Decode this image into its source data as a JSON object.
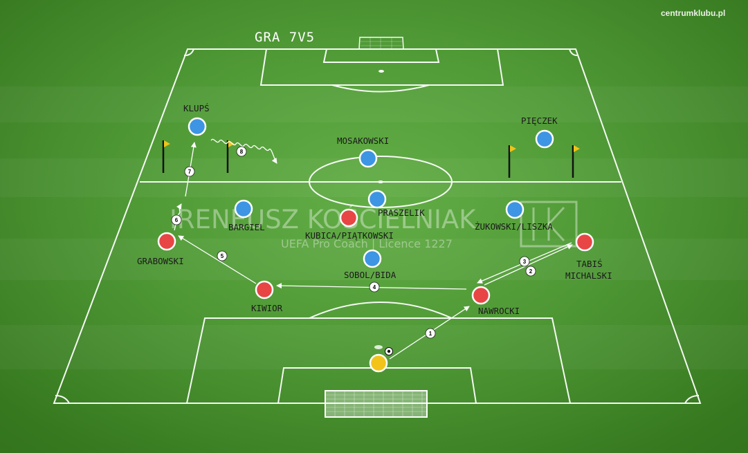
{
  "title": "GRA 7V5",
  "site": "centrumklubu.pl",
  "watermark": {
    "name": "IRENEUSZ KOŚCIELNIAK",
    "subtitle": "UEFA Pro Coach  |  Licence 1227"
  },
  "colors": {
    "blue_team": "#3d95e3",
    "red_team": "#e84545",
    "goalkeeper": "#f2c31a",
    "lines": "#ffffff",
    "flag": "#f2c31a"
  },
  "players": [
    {
      "id": "klups",
      "label": "KLUPŚ",
      "team": "blue"
    },
    {
      "id": "mosakowski",
      "label": "MOSAKOWSKI",
      "team": "blue"
    },
    {
      "id": "pieczek",
      "label": "PIĘCZEK",
      "team": "blue"
    },
    {
      "id": "praszelik",
      "label": "PRASZELIK",
      "team": "blue"
    },
    {
      "id": "bargiel",
      "label": "BARGIEL",
      "team": "blue"
    },
    {
      "id": "zukowski",
      "label": "ŻUKOWSKI/LISZKA",
      "team": "blue"
    },
    {
      "id": "sobol",
      "label": "SOBOL/BIDA",
      "team": "blue"
    },
    {
      "id": "kubica",
      "label": "KUBICA/PIĄTKOWSKI",
      "team": "red"
    },
    {
      "id": "grabowski",
      "label": "GRABOWSKI",
      "team": "red"
    },
    {
      "id": "tabis",
      "label": "TABIŚ",
      "team": "red"
    },
    {
      "id": "michalski",
      "label": "MICHALSKI",
      "team": "red"
    },
    {
      "id": "kiwior",
      "label": "KIWIOR",
      "team": "red"
    },
    {
      "id": "nawrocki",
      "label": "NAWROCKI",
      "team": "red"
    },
    {
      "id": "goalkeeper",
      "label": "",
      "team": "keeper"
    }
  ],
  "steps": [
    "1",
    "2",
    "3",
    "4",
    "5",
    "6",
    "7",
    "8"
  ]
}
